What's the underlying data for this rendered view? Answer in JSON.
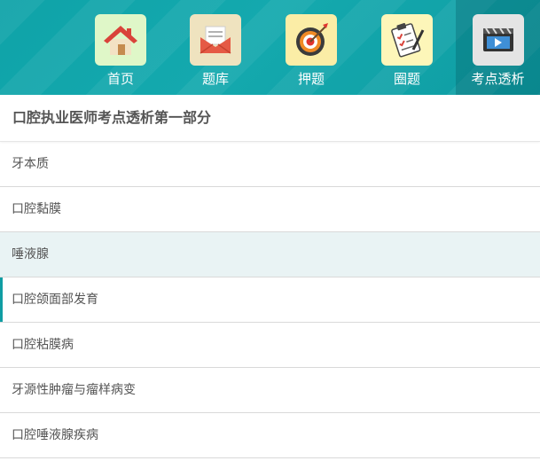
{
  "nav": {
    "items": [
      {
        "label": "首页",
        "icon": "home-icon"
      },
      {
        "label": "题库",
        "icon": "envelope-icon"
      },
      {
        "label": "押题",
        "icon": "target-icon"
      },
      {
        "label": "圈题",
        "icon": "clipboard-icon"
      },
      {
        "label": "考点透析",
        "icon": "video-icon"
      }
    ],
    "active_index": 4
  },
  "section": {
    "title": "口腔执业医师考点透析第一部分"
  },
  "list": {
    "items": [
      {
        "label": "牙本质"
      },
      {
        "label": "口腔黏膜"
      },
      {
        "label": "唾液腺"
      },
      {
        "label": "口腔颌面部发育"
      },
      {
        "label": "口腔粘膜病"
      },
      {
        "label": "牙源性肿瘤与瘤样病变"
      },
      {
        "label": "口腔唾液腺疾病"
      }
    ]
  },
  "colors": {
    "nav_bg": "#0fa3a8",
    "highlight_row": "#e9f3f4",
    "accent": "#0f9da3"
  }
}
